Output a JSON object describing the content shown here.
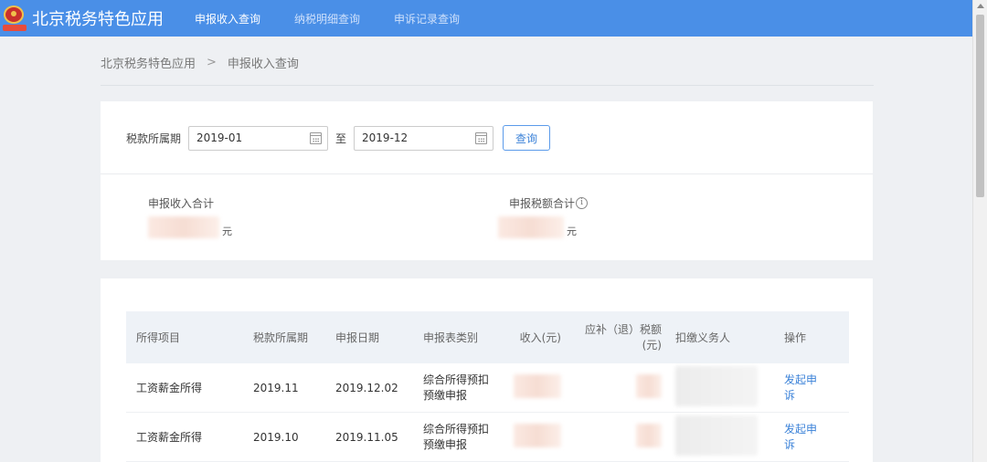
{
  "header": {
    "brand": "北京税务特色应用",
    "nav": [
      {
        "label": "申报收入查询",
        "active": true
      },
      {
        "label": "纳税明细查询",
        "active": false
      },
      {
        "label": "申诉记录查询",
        "active": false
      }
    ],
    "color": "#4a8fe7"
  },
  "breadcrumb": {
    "root": "北京税务特色应用",
    "separator": ">",
    "current": "申报收入查询"
  },
  "filter": {
    "label": "税款所属期",
    "start": "2019-01",
    "to": "至",
    "end": "2019-12",
    "query_button": "查询"
  },
  "summary": {
    "income_label": "申报收入合计",
    "income_unit": "元",
    "tax_label": "申报税额合计",
    "tax_unit": "元",
    "info_glyph": "i"
  },
  "table": {
    "headers": [
      "所得项目",
      "税款所属期",
      "申报日期",
      "申报表类别",
      "收入(元)",
      "应补（退）税额(元)",
      "扣缴义务人",
      "操作"
    ],
    "rows": [
      {
        "item": "工资薪金所得",
        "period": "2019.11",
        "date": "2019.12.02",
        "form": "综合所得预扣预缴申报",
        "action": "发起申诉"
      },
      {
        "item": "工资薪金所得",
        "period": "2019.10",
        "date": "2019.11.05",
        "form": "综合所得预扣预缴申报",
        "action": "发起申诉"
      }
    ]
  }
}
